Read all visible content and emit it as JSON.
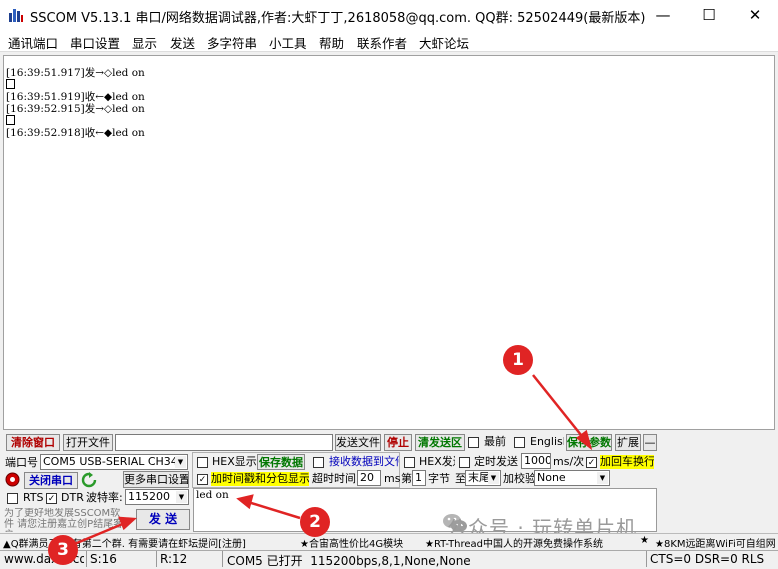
{
  "window": {
    "title": "SSCOM V5.13.1 串口/网络数据调试器,作者:大虾丁丁,2618058@qq.com. QQ群: 52502449(最新版本)"
  },
  "menu": [
    "通讯端口",
    "串口设置",
    "显示",
    "发送",
    "多字符串",
    "小工具",
    "帮助",
    "联系作者",
    "大虾论坛"
  ],
  "receive": {
    "lines": [
      {
        "ts": "[16:39:51.917]",
        "dir": "发→◇",
        "text": "led on"
      },
      {
        "ts": "[16:39:51.919]",
        "dir": "收←◆",
        "text": "led on"
      },
      {
        "ts": "[16:39:52.915]",
        "dir": "发→◇",
        "text": "led on"
      },
      {
        "ts": "[16:39:52.918]",
        "dir": "收←◆",
        "text": "led on"
      }
    ]
  },
  "toolbar": {
    "clear": "清除窗口",
    "open_file": "打开文件",
    "send_file": "发送文件",
    "stop": "停止",
    "clear_send": "清发送区",
    "front": "最前",
    "english": "English",
    "save_params": "保存参数",
    "expand": "扩展",
    "collapse": "—"
  },
  "port": {
    "port_label": "端口号",
    "port_value": "COM5 USB-SERIAL CH340",
    "more_settings": "更多串口设置",
    "close_port": "关闭串口",
    "rts": "RTS",
    "dtr": "DTR",
    "baud_label": "波特率:",
    "baud_value": "115200",
    "promo": "为了更好地发展SSCOM软件 请您注册嘉立创P结尾客户"
  },
  "options": {
    "hex_display": "HEX显示",
    "save_data": "保存数据",
    "recv_to_file": "接收数据到文件",
    "hex_send": "HEX发送",
    "timed_send": "定时发送",
    "interval": "1000",
    "interval_unit": "ms/次",
    "add_crlf": "加回车换行",
    "timestamp": "加时间戳和分包显示",
    "timeout_label": "超时时间",
    "timeout_value": "20",
    "timeout_unit": "ms",
    "byte_prefix": "第",
    "byte_num": "1",
    "byte_label": "字节",
    "to_label": "至",
    "end_value": "末尾",
    "checksum_label": "加校验",
    "checksum_value": "None"
  },
  "send": {
    "text": "led on",
    "button": "发  送"
  },
  "ticker": [
    "▲Q群满员了,没有第二个群. 有需要请在虾坛提问[注册]",
    "★合宙高性价比4G模块",
    "★RT-Thread中国人的开源免费操作系统",
    "★",
    "★8KM远距离WiFi可自组网"
  ],
  "status": {
    "site": "www.daxia.com",
    "sent": "S:16",
    "recv": "R:12",
    "port_state": "COM5 已打开  115200bps,8,1,None,None",
    "signals": "CTS=0 DSR=0 RLS"
  },
  "annotations": {
    "b1": "1",
    "b2": "2",
    "b3": "3"
  },
  "watermark": "公众号 · 玩转单片机",
  "colors": {
    "accent_red": "#e02424",
    "highlight": "#ffff00"
  }
}
